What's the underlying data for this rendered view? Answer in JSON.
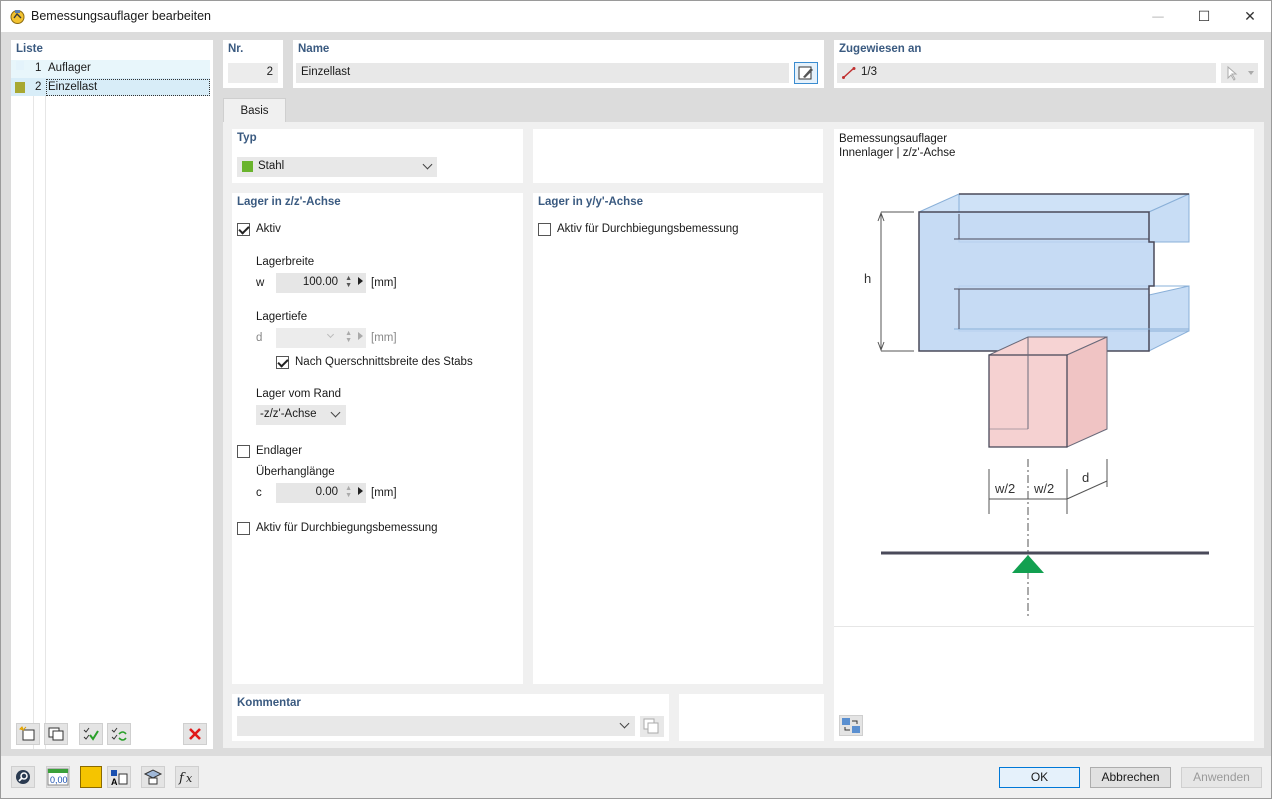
{
  "window": {
    "title": "Bemessungsauflager bearbeiten",
    "minimize_glyph": "—",
    "maximize_glyph": "☐",
    "close_glyph": "✕"
  },
  "list": {
    "header": "Liste",
    "items": [
      {
        "num": "1",
        "name": "Auflager",
        "color": "#cfe8ff"
      },
      {
        "num": "2",
        "name": "Einzellast",
        "color": "#a8a832"
      }
    ]
  },
  "nr": {
    "label": "Nr.",
    "value": "2"
  },
  "name": {
    "label": "Name",
    "value": "Einzellast"
  },
  "assigned": {
    "label": "Zugewiesen an",
    "value": "1/3"
  },
  "tabs": [
    {
      "label": "Basis"
    }
  ],
  "typ": {
    "label": "Typ",
    "value": "Stahl",
    "color": "#6ab42d"
  },
  "zz": {
    "label": "Lager in z/z'-Achse",
    "aktiv": "Aktiv",
    "lagerbreite": "Lagerbreite",
    "w_sym": "w",
    "w_val": "100.00",
    "unit": "[mm]",
    "lagertiefe": "Lagertiefe",
    "d_sym": "d",
    "d_val": "",
    "nach_quer": "Nach Querschnittsbreite des Stabs",
    "rand": "Lager vom Rand",
    "rand_value": "-z/z'-Achse",
    "endlager": "Endlager",
    "ueber": "Überhanglänge",
    "c_sym": "c",
    "c_val": "0.00",
    "durch": "Aktiv für Durchbiegungsbemessung"
  },
  "yy": {
    "label": "Lager in y/y'-Achse",
    "durch": "Aktiv für Durchbiegungsbemessung"
  },
  "diagram": {
    "title1": "Bemessungsauflager",
    "title2": "Innenlager | z/z'-Achse",
    "h": "h",
    "w2a": "w/2",
    "w2b": "w/2",
    "d": "d"
  },
  "kommentar": {
    "label": "Kommentar",
    "value": ""
  },
  "buttons": {
    "ok": "OK",
    "cancel": "Abbrechen",
    "apply": "Anwenden"
  },
  "bottom_value_icon": "0,00"
}
